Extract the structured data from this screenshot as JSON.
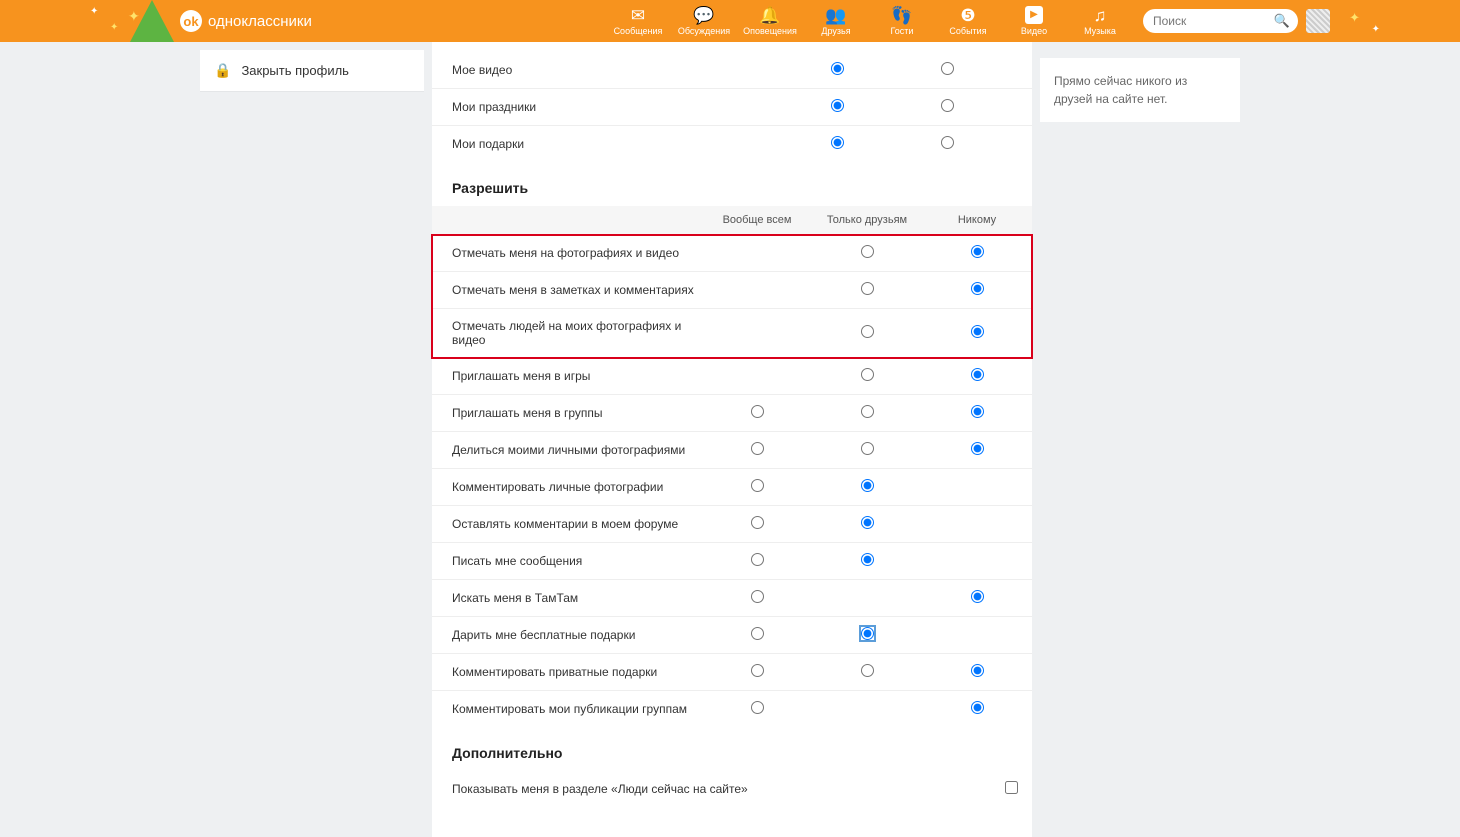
{
  "header": {
    "logo_text": "одноклассники",
    "nav": [
      {
        "label": "Сообщения"
      },
      {
        "label": "Обсуждения"
      },
      {
        "label": "Оповещения"
      },
      {
        "label": "Друзья"
      },
      {
        "label": "Гости"
      },
      {
        "label": "События"
      },
      {
        "label": "Видео"
      },
      {
        "label": "Музыка"
      }
    ],
    "search_placeholder": "Поиск"
  },
  "sidebar_left": {
    "close_profile": "Закрыть профиль"
  },
  "sidebar_right": {
    "friends_status": "Прямо сейчас никого из друзей на сайте нет."
  },
  "sections": {
    "top_rows": [
      {
        "label": "Мое видео",
        "selected": 0
      },
      {
        "label": "Мои праздники",
        "selected": 0
      },
      {
        "label": "Мои подарки",
        "selected": 0
      }
    ],
    "allow_title": "Разрешить",
    "allow_headers": [
      "",
      "Вообще всем",
      "Только друзьям",
      "Никому"
    ],
    "allow_rows": [
      {
        "label": "Отмечать меня на фотографиях и видео",
        "cols": [
          null,
          1,
          2
        ],
        "selected": 2,
        "hl": true
      },
      {
        "label": "Отмечать меня в заметках и комментариях",
        "cols": [
          null,
          1,
          2
        ],
        "selected": 2,
        "hl": true
      },
      {
        "label": "Отмечать людей на моих фотографиях и видео",
        "cols": [
          null,
          1,
          2
        ],
        "selected": 2,
        "hl": true
      },
      {
        "label": "Приглашать меня в игры",
        "cols": [
          null,
          1,
          2
        ],
        "selected": 2
      },
      {
        "label": "Приглашать меня в группы",
        "cols": [
          0,
          1,
          2
        ],
        "selected": 2
      },
      {
        "label": "Делиться моими личными фотографиями",
        "cols": [
          0,
          1,
          2
        ],
        "selected": 2
      },
      {
        "label": "Комментировать личные фотографии",
        "cols": [
          0,
          1,
          null
        ],
        "selected": 1
      },
      {
        "label": "Оставлять комментарии в моем форуме",
        "cols": [
          0,
          1,
          null
        ],
        "selected": 1
      },
      {
        "label": "Писать мне сообщения",
        "cols": [
          0,
          1,
          null
        ],
        "selected": 1
      },
      {
        "label": "Искать меня в ТамТам",
        "cols": [
          0,
          null,
          2
        ],
        "selected": 2
      },
      {
        "label": "Дарить мне бесплатные подарки",
        "cols": [
          0,
          1,
          null
        ],
        "selected": 1,
        "focused": true
      },
      {
        "label": "Комментировать приватные подарки",
        "cols": [
          0,
          1,
          2
        ],
        "selected": 2
      },
      {
        "label": "Комментировать мои публикации группам",
        "cols": [
          0,
          null,
          2
        ],
        "selected": 2
      }
    ],
    "extra_title": "Дополнительно",
    "extra_rows": [
      {
        "label": "Показывать меня в разделе «Люди сейчас на сайте»",
        "checked": false
      }
    ]
  }
}
